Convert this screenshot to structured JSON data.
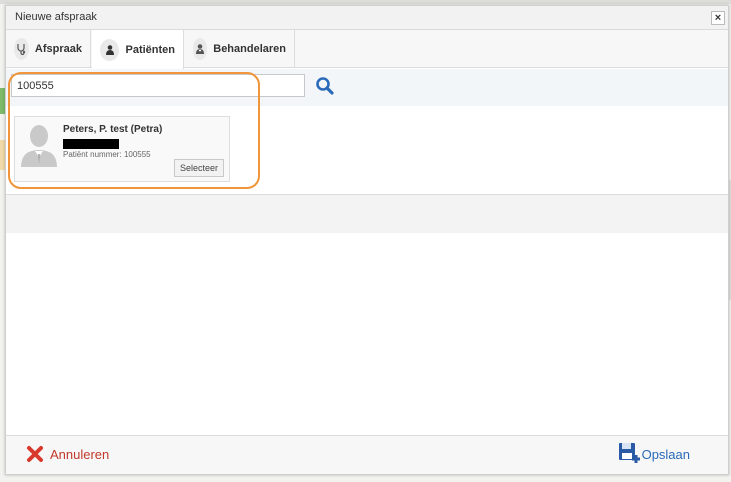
{
  "dialog": {
    "title": "Nieuwe afspraak",
    "close_label": "×"
  },
  "tabs": [
    {
      "label": "Afspraak",
      "icon": "stethoscope-icon"
    },
    {
      "label": "Patiënten",
      "icon": "user-icon"
    },
    {
      "label": "Behandelaren",
      "icon": "doctor-icon"
    }
  ],
  "active_tab": "Patiënten",
  "search": {
    "value": "100555",
    "placeholder": ""
  },
  "results": [
    {
      "name": "Peters, P. test (Petra)",
      "number_label": "Patiënt nummer:",
      "number": "100555",
      "select_label": "Selecteer"
    }
  ],
  "footer": {
    "cancel_label": "Annuleren",
    "save_label": "Opslaan"
  },
  "colors": {
    "highlight": "#f0953a",
    "cancel": "#c0392b",
    "save": "#2a6ab8",
    "search_icon": "#2a6ab8"
  }
}
